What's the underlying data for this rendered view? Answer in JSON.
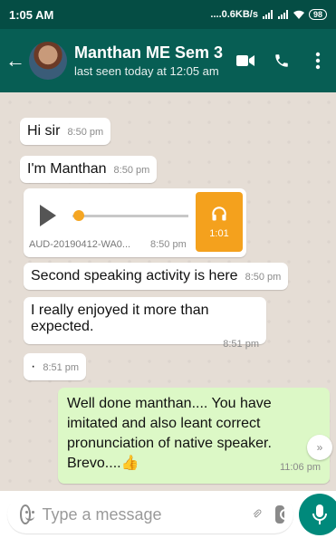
{
  "status_bar": {
    "time": "1:05 AM",
    "net_speed": "....0.6KB/s",
    "battery": "98"
  },
  "header": {
    "contact_name": "Manthan ME Sem 3",
    "last_seen": "last seen today at 12:05 am"
  },
  "messages": [
    {
      "text": "Hi sir",
      "time": "8:50 pm",
      "direction": "incoming"
    },
    {
      "text": "I'm Manthan",
      "time": "8:50 pm",
      "direction": "incoming"
    },
    {
      "type": "voice_note",
      "filename": "AUD-20190412-WA0...",
      "time": "8:50 pm",
      "duration": "1:01",
      "direction": "incoming"
    },
    {
      "text": "Second speaking activity is here",
      "time": "8:50 pm",
      "direction": "incoming"
    },
    {
      "text": "I really enjoyed it more than expected.",
      "time": "8:51 pm",
      "direction": "incoming"
    },
    {
      "text": "·",
      "time": "8:51 pm",
      "direction": "incoming"
    },
    {
      "text": "Well done manthan.... You have imitated and also leant correct pronunciation of native speaker. Brevo....👍",
      "time": "11:06 pm",
      "direction": "outgoing"
    }
  ],
  "input": {
    "placeholder": "Type a message"
  },
  "colors": {
    "header": "#075e54",
    "status_bar": "#054d44",
    "chat_bg": "#e5ddd5",
    "outgoing_bubble": "#dcf8c6",
    "mic_button": "#00897b",
    "voice_accent": "#f4a11d"
  }
}
